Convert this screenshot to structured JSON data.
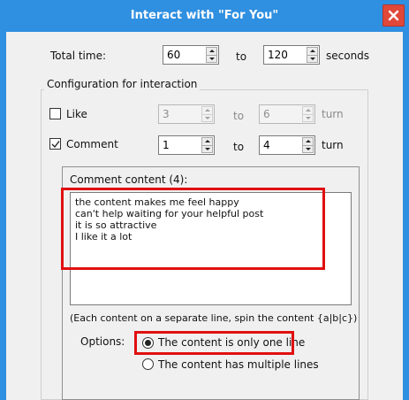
{
  "window": {
    "title": "Interact with \"For You\"",
    "accent": "#2f8fe0",
    "close_color": "#e0483a"
  },
  "total_time": {
    "label": "Total time:",
    "from": "60",
    "to_label": "to",
    "to": "120",
    "unit": "seconds"
  },
  "config": {
    "group_label": "Configuration for interaction",
    "like": {
      "label": "Like",
      "checked": false,
      "from": "3",
      "to_label": "to",
      "to": "6",
      "unit": "turn"
    },
    "comment": {
      "label": "Comment",
      "checked": true,
      "from": "1",
      "to_label": "to",
      "to": "4",
      "unit": "turn"
    }
  },
  "comment_content": {
    "label": "Comment content (4):",
    "lines": [
      "the content makes me feel happy",
      "can't help waiting for your helpful post",
      "it is so attractive",
      "I like it a lot"
    ],
    "hint": "(Each content on a separate line, spin the content {a|b|c})"
  },
  "options": {
    "label": "Options:",
    "choices": [
      {
        "label": "The content is only one line",
        "selected": true
      },
      {
        "label": "The content has multiple lines",
        "selected": false
      }
    ]
  },
  "highlight_color": "#e01010"
}
